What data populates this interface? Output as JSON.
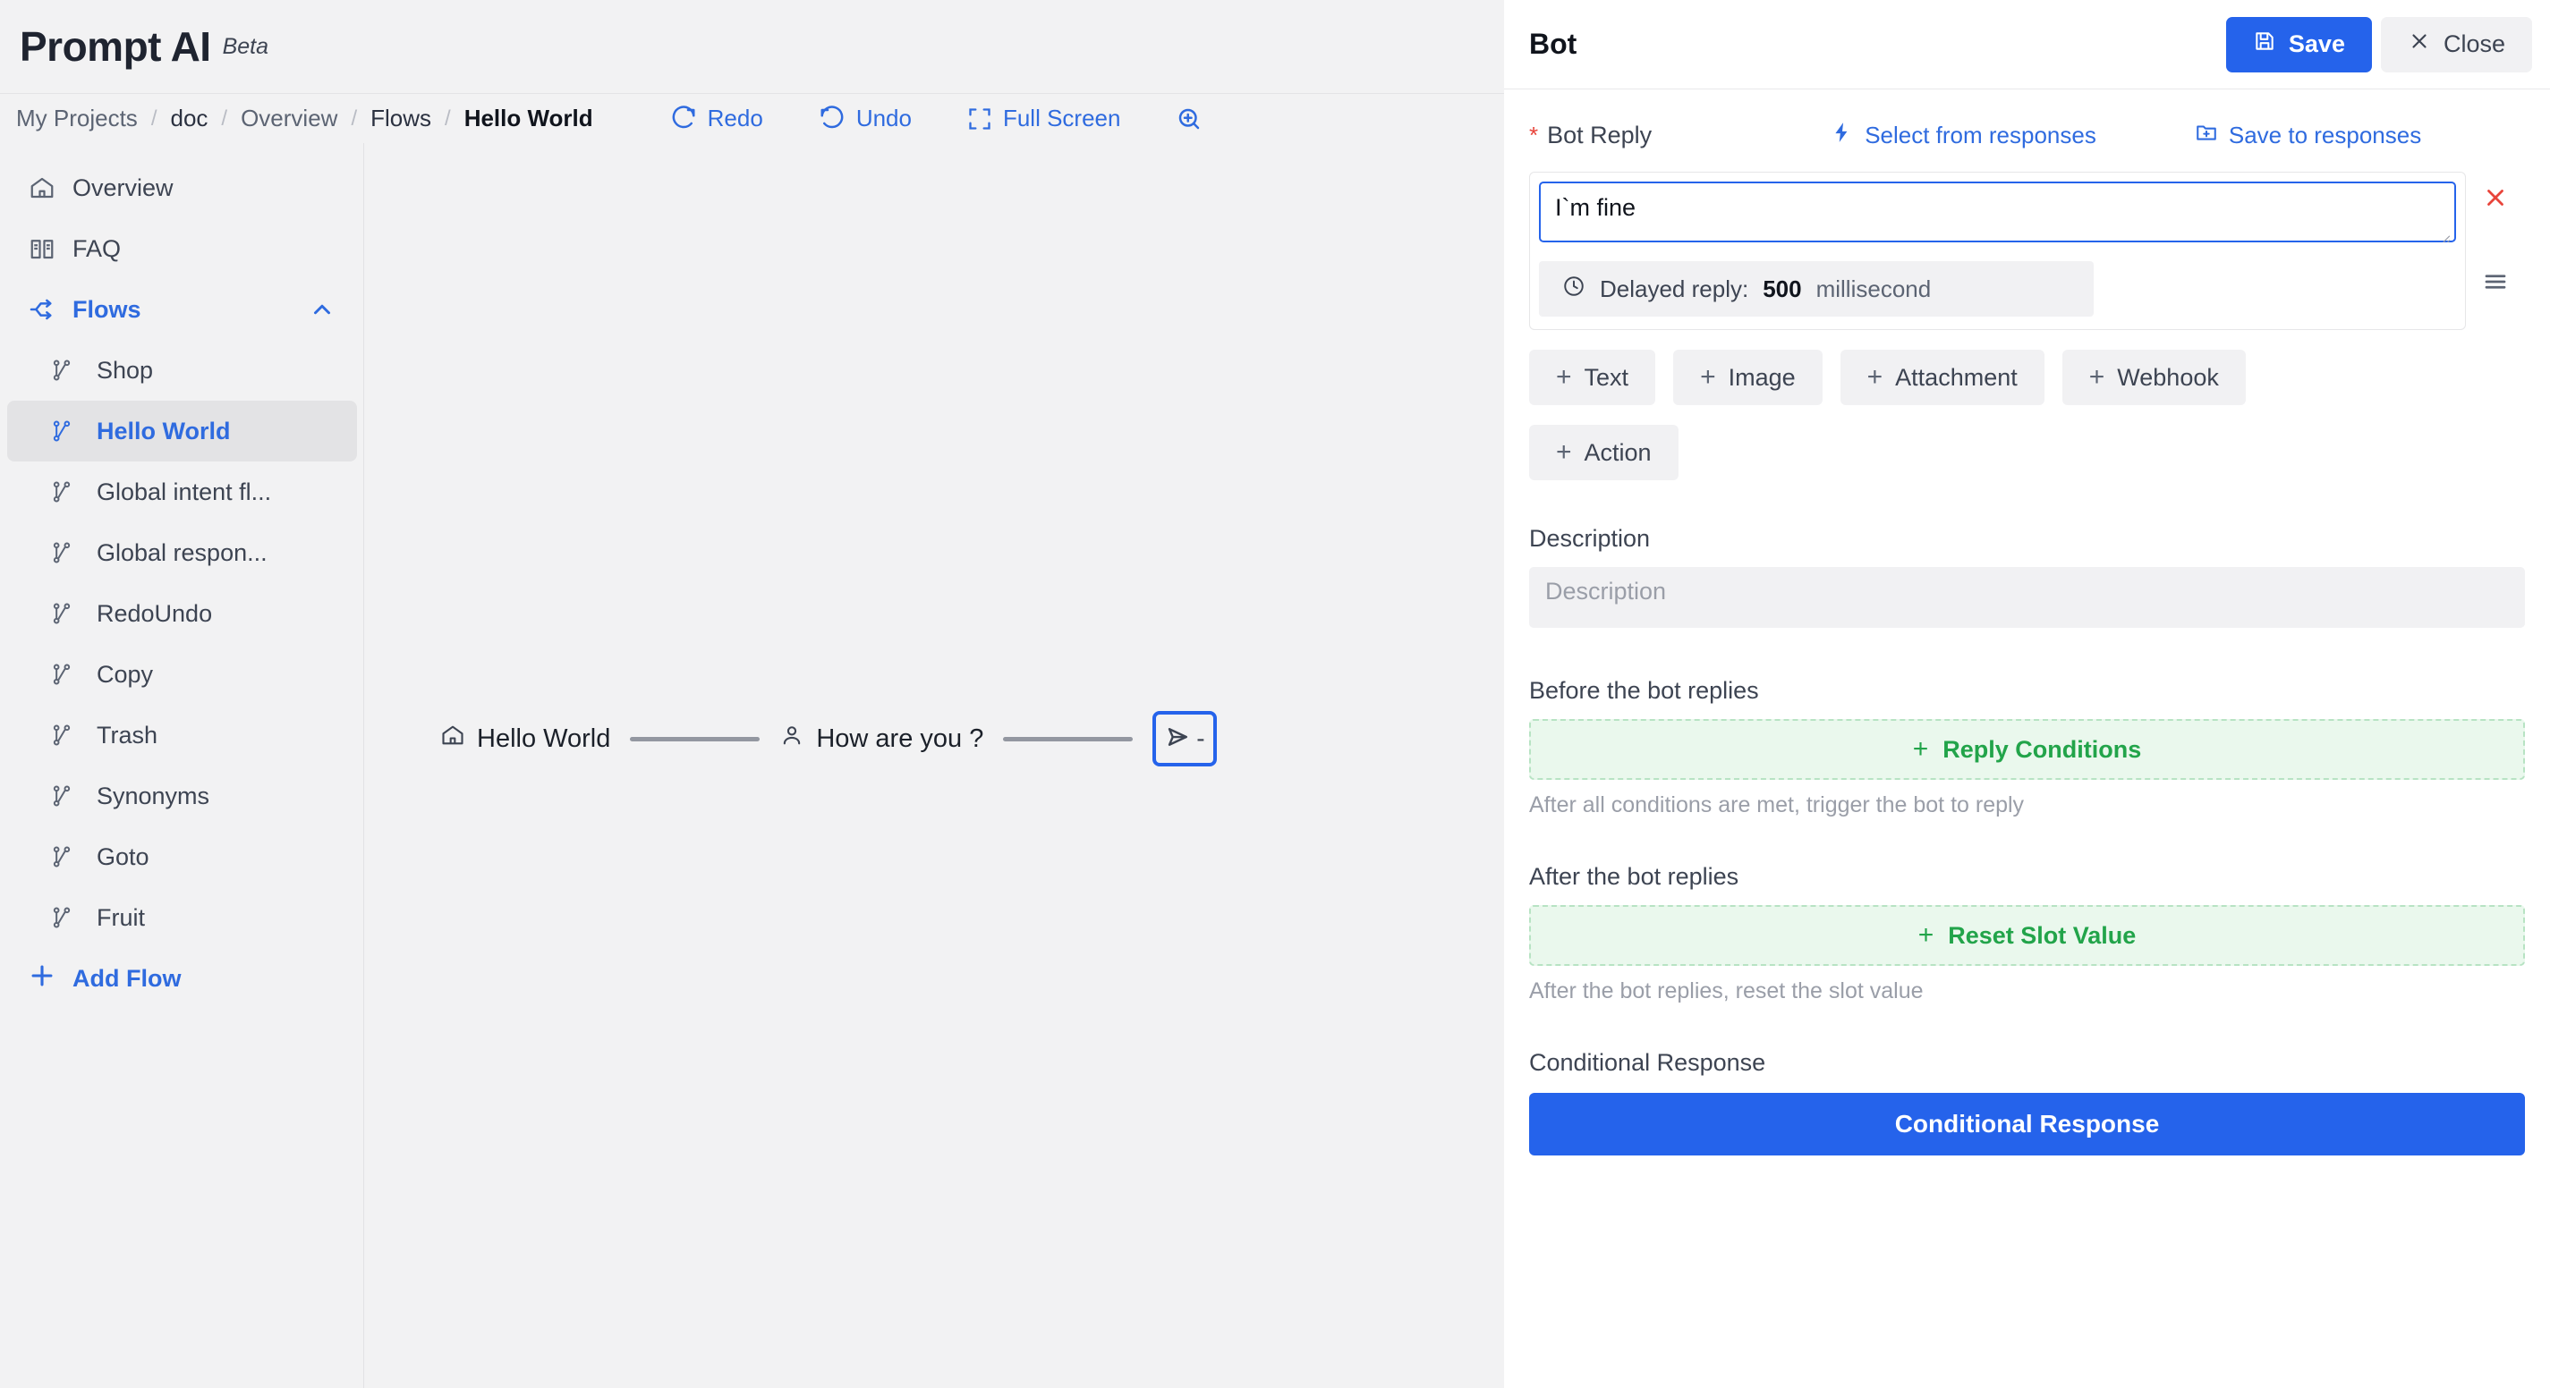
{
  "brand": {
    "title": "Prompt AI",
    "tag": "Beta"
  },
  "breadcrumb": {
    "items": [
      {
        "label": "My Projects",
        "style": "muted"
      },
      {
        "label": "doc",
        "style": "dark"
      },
      {
        "label": "Overview",
        "style": "muted"
      },
      {
        "label": "Flows",
        "style": "dark"
      },
      {
        "label": "Hello World",
        "style": "current"
      }
    ],
    "separator": "/"
  },
  "toolbar": {
    "redo_label": "Redo",
    "undo_label": "Undo",
    "fullscreen_label": "Full Screen",
    "zoom_icon": "zoom-in-icon"
  },
  "sidebar": {
    "items": [
      {
        "label": "Overview",
        "icon": "home-icon",
        "level": 0,
        "state": "normal"
      },
      {
        "label": "FAQ",
        "icon": "book-icon",
        "level": 0,
        "state": "normal"
      },
      {
        "label": "Flows",
        "icon": "flow-branch-icon",
        "level": 0,
        "state": "active-parent",
        "chevron": "chevron-up-icon"
      },
      {
        "label": "Shop",
        "icon": "branch-icon",
        "level": 1,
        "state": "normal"
      },
      {
        "label": "Hello World",
        "icon": "branch-icon",
        "level": 1,
        "state": "selected"
      },
      {
        "label": "Global intent fl...",
        "icon": "branch-icon",
        "level": 1,
        "state": "normal"
      },
      {
        "label": "Global respon...",
        "icon": "branch-icon",
        "level": 1,
        "state": "normal"
      },
      {
        "label": "RedoUndo",
        "icon": "branch-icon",
        "level": 1,
        "state": "normal"
      },
      {
        "label": "Copy",
        "icon": "branch-icon",
        "level": 1,
        "state": "normal"
      },
      {
        "label": "Trash",
        "icon": "branch-icon",
        "level": 1,
        "state": "normal"
      },
      {
        "label": "Synonyms",
        "icon": "branch-icon",
        "level": 1,
        "state": "normal"
      },
      {
        "label": "Goto",
        "icon": "branch-icon",
        "level": 1,
        "state": "normal"
      },
      {
        "label": "Fruit",
        "icon": "branch-icon",
        "level": 1,
        "state": "normal"
      }
    ],
    "add_flow_label": "Add Flow",
    "add_flow_icon": "plus-icon"
  },
  "canvas": {
    "nodes": [
      {
        "label": "Hello World",
        "icon": "home-icon",
        "type": "start"
      },
      {
        "label": "How are you ?",
        "icon": "user-icon",
        "type": "user"
      },
      {
        "label": "-",
        "icon": "send-icon",
        "type": "bot",
        "selected": true
      }
    ]
  },
  "panel": {
    "title": "Bot",
    "save_label": "Save",
    "save_icon": "floppy-disk-icon",
    "close_label": "Close",
    "close_icon": "close-x-icon",
    "bot_reply": {
      "label": "Bot Reply",
      "required_mark": "*",
      "select_from_responses_label": "Select from responses",
      "select_icon": "lightning-icon",
      "save_to_responses_label": "Save to responses",
      "save_to_icon": "folder-plus-icon",
      "text_value": "I`m fine",
      "delay_icon": "clock-icon",
      "delay_label": "Delayed reply:",
      "delay_value": "500",
      "delay_unit": "millisecond",
      "delete_icon": "close-x-icon",
      "drag_icon": "drag-handle-icon"
    },
    "add_buttons": [
      {
        "label": "Text"
      },
      {
        "label": "Image"
      },
      {
        "label": "Attachment"
      },
      {
        "label": "Webhook"
      },
      {
        "label": "Action"
      }
    ],
    "description": {
      "label": "Description",
      "placeholder": "Description",
      "value": ""
    },
    "before_reply": {
      "title": "Before the bot replies",
      "action_label": "Reply Conditions",
      "hint": "After all conditions are met, trigger the bot to reply"
    },
    "after_reply": {
      "title": "After the bot replies",
      "action_label": "Reset Slot Value",
      "hint": "After the bot replies, reset the slot value"
    },
    "conditional": {
      "title": "Conditional Response",
      "button_label": "Conditional Response"
    }
  },
  "colors": {
    "accent_blue": "#2563eb",
    "link_blue": "#2f6bdf",
    "green": "#22a44a",
    "green_bg": "#eaf8ed",
    "red": "#e8443a",
    "canvas_bg": "#f2f2f3"
  }
}
